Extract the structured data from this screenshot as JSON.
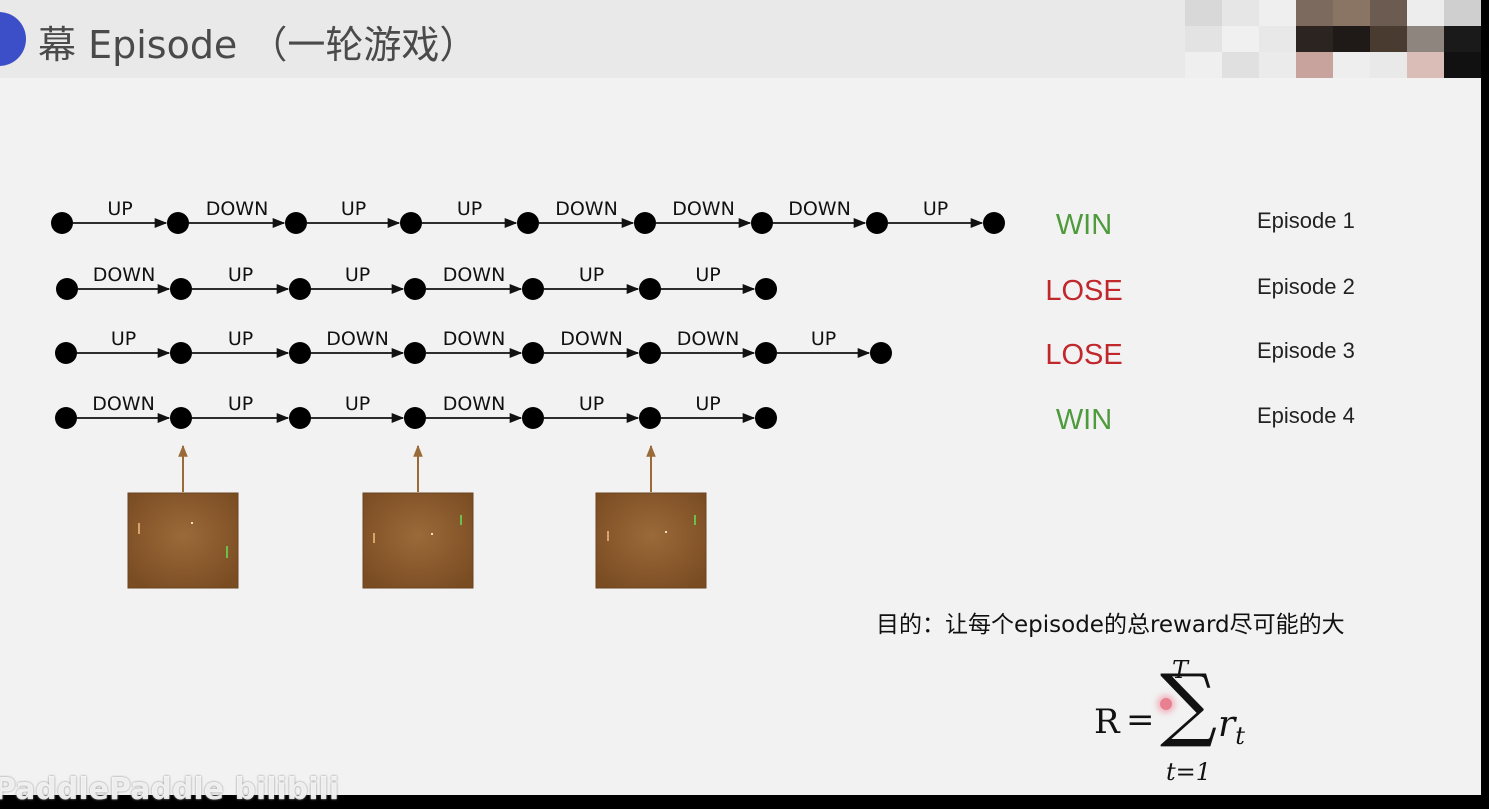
{
  "header": {
    "title": "幕 Episode （一轮游戏）"
  },
  "episodes": [
    {
      "label": "Episode 1",
      "result": "WIN",
      "actions": [
        "UP",
        "DOWN",
        "UP",
        "UP",
        "DOWN",
        "DOWN",
        "DOWN",
        "UP"
      ]
    },
    {
      "label": "Episode 2",
      "result": "LOSE",
      "actions": [
        "DOWN",
        "UP",
        "UP",
        "DOWN",
        "UP",
        "UP"
      ]
    },
    {
      "label": "Episode 3",
      "result": "LOSE",
      "actions": [
        "UP",
        "UP",
        "DOWN",
        "DOWN",
        "DOWN",
        "DOWN",
        "UP"
      ]
    },
    {
      "label": "Episode 4",
      "result": "WIN",
      "actions": [
        "DOWN",
        "UP",
        "UP",
        "DOWN",
        "UP",
        "UP"
      ]
    }
  ],
  "colors": {
    "win": "#4e9a3c",
    "lose": "#c0282d",
    "frame": "#8a5a2b",
    "arrow": "#9a6a38"
  },
  "goal": "目的：让每个episode的总reward尽可能的大",
  "formula": {
    "lhs": "R",
    "eq": "=",
    "sum": "∑",
    "upper": "T",
    "lower": "t=1",
    "term": "r",
    "sub": "t"
  },
  "watermark": "PaddlePaddle  bilibili"
}
